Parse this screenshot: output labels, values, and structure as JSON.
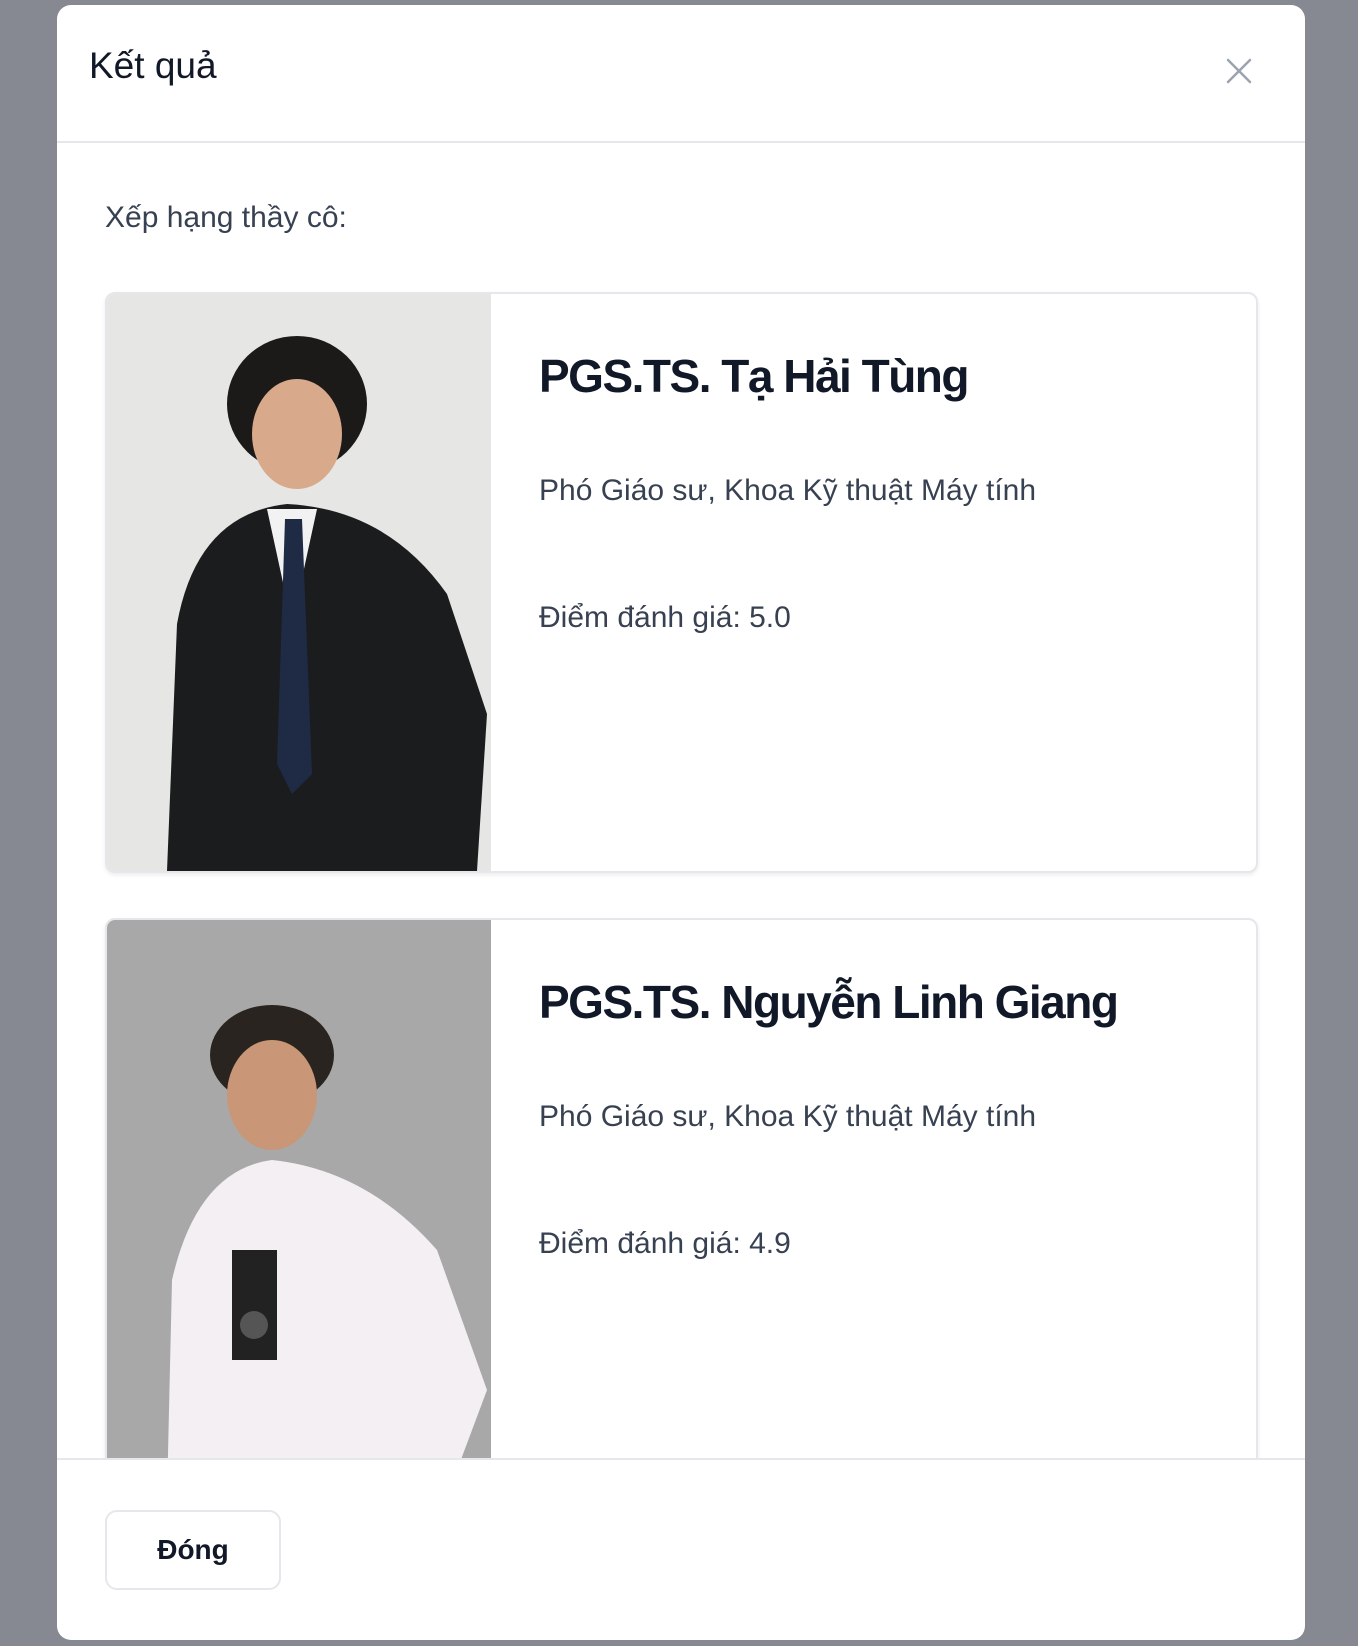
{
  "modal": {
    "title": "Kết quả",
    "close_icon": "close-icon"
  },
  "body": {
    "label": "Xếp hạng thầy cô:",
    "teachers": [
      {
        "name": "PGS.TS. Tạ Hải Tùng",
        "role": "Phó Giáo sư, Khoa Kỹ thuật Máy tính",
        "score": "Điểm đánh giá: 5.0",
        "photo_bg": "#e6e6e4"
      },
      {
        "name": "PGS.TS. Nguyễn Linh Giang",
        "role": "Phó Giáo sư, Khoa Kỹ thuật Máy tính",
        "score": "Điểm đánh giá: 4.9",
        "photo_bg": "#a8a8a8"
      }
    ]
  },
  "footer": {
    "close_label": "Đóng"
  }
}
